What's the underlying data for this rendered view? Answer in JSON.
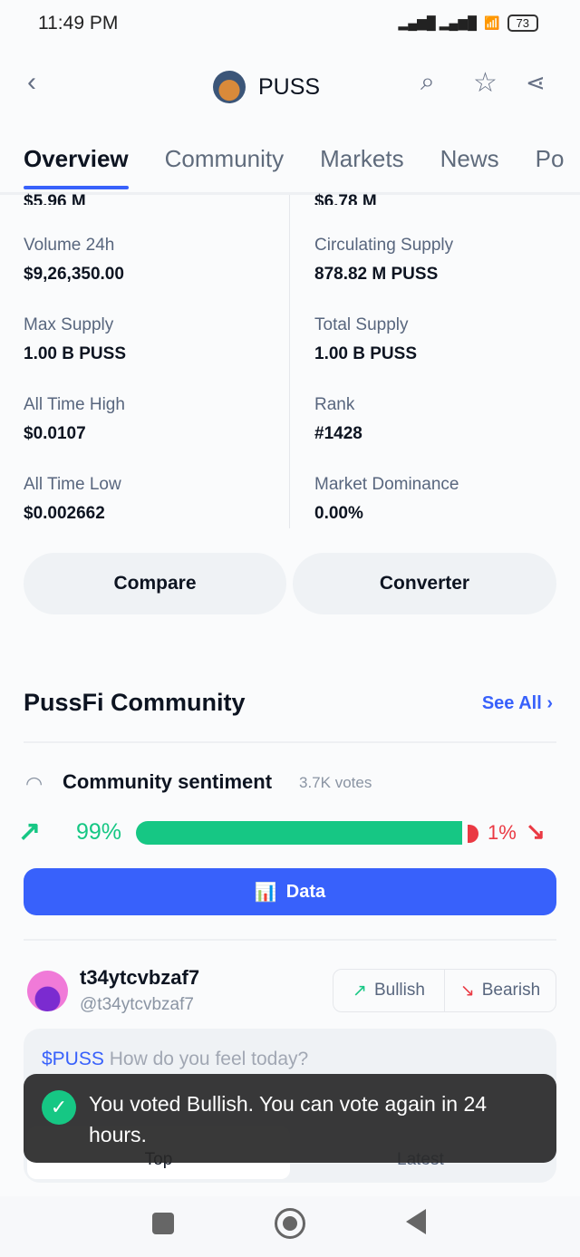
{
  "status_bar": {
    "time": "11:49 PM",
    "battery": "73"
  },
  "header": {
    "title": "PUSS"
  },
  "tabs": [
    "Overview",
    "Community",
    "Markets",
    "News",
    "Po"
  ],
  "stats": {
    "cut_left": "$5.96 M",
    "cut_right": "$6.78 M",
    "left": [
      {
        "label": "Volume 24h",
        "value": "$9,26,350.00"
      },
      {
        "label": "Max Supply",
        "value": "1.00 B PUSS"
      },
      {
        "label": "All Time High",
        "value": "$0.0107"
      },
      {
        "label": "All Time Low",
        "value": "$0.002662"
      }
    ],
    "right": [
      {
        "label": "Circulating Supply",
        "value": "878.82 M PUSS"
      },
      {
        "label": "Total Supply",
        "value": "1.00 B PUSS"
      },
      {
        "label": "Rank",
        "value": "#1428"
      },
      {
        "label": "Market Dominance",
        "value": "0.00%"
      }
    ]
  },
  "buttons": {
    "compare": "Compare",
    "converter": "Converter"
  },
  "community": {
    "title": "PussFi Community",
    "see_all": "See All",
    "sentiment_title": "Community sentiment",
    "votes": "3.7K votes",
    "bullish_pct": "99%",
    "bearish_pct": "1%",
    "bullish_fraction": 0.99,
    "data_btn": "Data",
    "bull_color": "#16c784",
    "bear_color": "#ea3943"
  },
  "user": {
    "name": "t34ytcvbzaf7",
    "handle": "@t34ytcvbzaf7",
    "bullish": "Bullish",
    "bearish": "Bearish"
  },
  "compose": {
    "tag": "$PUSS",
    "placeholder": "How do you feel today?",
    "tab_top": "Top",
    "tab_latest": "Latest"
  },
  "toast": {
    "message": "You voted Bullish. You can vote again in 24 hours."
  }
}
